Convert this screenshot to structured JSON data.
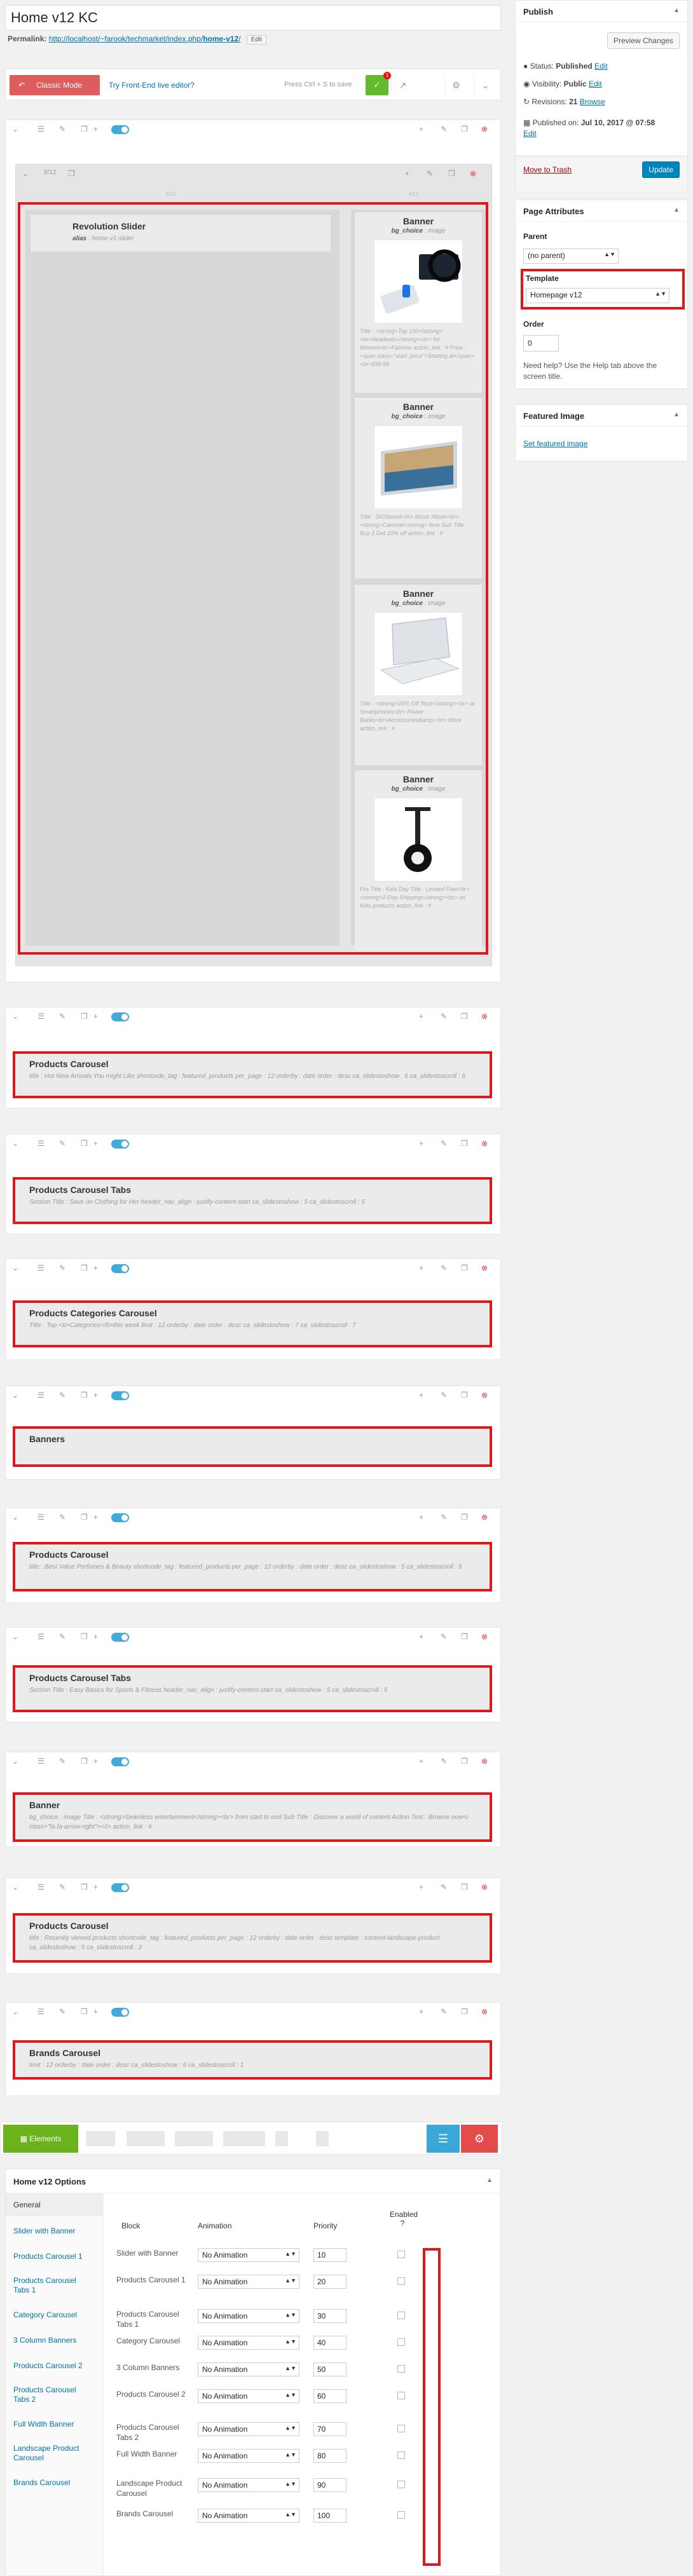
{
  "title_value": "Home v12 KC",
  "permalink": {
    "label": "Permalink:",
    "url_prefix": "http://localhost/~farook/techmarket/index.php/",
    "slug": "home-v12",
    "url_suffix": "/",
    "edit": "Edit"
  },
  "toolbar": {
    "classic_mode": "Classic Mode",
    "frontend_link": "Try Front-End live editor?",
    "save_hint": "Press Ctrl + S to save",
    "badge": "1"
  },
  "rev_slider": {
    "title": "Revolution Slider",
    "attr_key": "alias",
    "attr_value": ": home-v1-slider"
  },
  "col_widths": {
    "left": "8/12",
    "right": "4/12"
  },
  "banners": [
    {
      "title": "Banner",
      "key": "bg_choice",
      "val": ": image",
      "desc": "Title : <strong>Top 100</strong><br>Headsets</strong><br> for Women<br>Fashion action_link : # Price : <span class=\"start_price\">Starting at</span><br>$99.99"
    },
    {
      "title": "Banner",
      "key": "bg_choice",
      "val": ": image",
      "desc": "Title : 360Sound<br> Music Album<br><strong>Carnival</strong> time Sub Title : Buy 3 Get 10% off action_link : #"
    },
    {
      "title": "Banner",
      "key": "bg_choice",
      "val": ": image",
      "desc": "Title : <strong>20% Off Tech</strong><br> at Smartphones<br> Power Banks<br>Accessories&amp;<br> More action_link : #"
    },
    {
      "title": "Banner",
      "key": "bg_choice",
      "val": ": image",
      "desc": "Pre Title : Kids Day Title : Limited Free<br><strong>2-Day Shipping</strong><br> on Kids products action_link : #"
    }
  ],
  "rows": [
    {
      "title": "Products Carousel",
      "desc": "title : Hot New Arrivals You might Like shortcode_tag : featured_products per_page : 12 orderby : date order : desc ca_slidestoshow : 6 ca_slidestoscroll : 6"
    },
    {
      "title": "Products Carousel Tabs",
      "desc": "Section Title : Save on Clothing for Her header_nav_align : justify-content-start ca_slidestoshow : 5 ca_slidestoscroll : 5"
    },
    {
      "title": "Products Categories Carousel",
      "desc": "Title : Top <b>Categories</b>this week limit : 12 orderby : date order : desc ca_slidestoshow : 7 ca_slidestoscroll : 7"
    },
    {
      "title": "Banners",
      "desc": ""
    },
    {
      "title": "Products Carousel",
      "desc": "title : Best Value Perfumes & Beauty shortcode_tag : featured_products per_page : 12 orderby : date order : desc ca_slidestoshow : 5 ca_slidestoscroll : 5"
    },
    {
      "title": "Products Carousel Tabs",
      "desc": "Section Title : Easy Basics for Sports & Fitness header_nav_align : justify-content-start ca_slidestoshow : 5 ca_slidestoscroll : 5"
    },
    {
      "title": "Banner",
      "desc": "bg_choice : image Title : <strong>Seamless entertainment</strong><br> from start to end Sub Title : Discover a world of content Action Text : Browse now<i class=\"fa fa-arrow-right\"></i> action_link : #"
    },
    {
      "title": "Products Carousel",
      "desc": "title : Recently viewed products shortcode_tag : featured_products per_page : 12 orderby : date order : desc template : content-landscape-product ca_slidestoshow : 5 ca_slidestoscroll : 2"
    },
    {
      "title": "Brands Carousel",
      "desc": "limit : 12 orderby : date order : desc ca_slidestoshow : 6 ca_slidestoscroll : 1"
    }
  ],
  "elements_label": "Elements",
  "publish": {
    "title": "Publish",
    "preview": "Preview Changes",
    "status_label": "Status:",
    "status": "Published",
    "visibility_label": "Visibility:",
    "visibility": "Public",
    "revisions_label": "Revisions:",
    "revisions": "21",
    "browse": "Browse",
    "published_label": "Published on:",
    "published_date": "Jul 10, 2017 @ 07:58",
    "edit": "Edit",
    "trash": "Move to Trash",
    "update": "Update"
  },
  "page_attributes": {
    "title": "Page Attributes",
    "parent_label": "Parent",
    "parent_value": "(no parent)",
    "template_label": "Template",
    "template_value": "Homepage v12",
    "order_label": "Order",
    "order_value": "0",
    "help": "Need help? Use the Help tab above the screen title."
  },
  "featured_image": {
    "title": "Featured Image",
    "link": "Set featured image"
  },
  "options": {
    "title": "Home v12 Options",
    "nav": [
      "General",
      "Slider with Banner",
      "Products Carousel 1",
      "Products Carousel Tabs 1",
      "Category Carousel",
      "3 Column Banners",
      "Products Carousel 2",
      "Products Carousel Tabs 2",
      "Full Width Banner",
      "Landscape Product Carousel",
      "Brands Carousel"
    ],
    "headers": {
      "block": "Block",
      "animation": "Animation",
      "priority": "Priority",
      "enabled": "Enabled ?"
    },
    "rows": [
      {
        "block": "Slider with Banner",
        "animation": "No Animation",
        "priority": "10"
      },
      {
        "block": "Products Carousel 1",
        "animation": "No Animation",
        "priority": "20"
      },
      {
        "block": "Products Carousel Tabs 1",
        "animation": "No Animation",
        "priority": "30"
      },
      {
        "block": "Category Carousel",
        "animation": "No Animation",
        "priority": "40"
      },
      {
        "block": "3 Column Banners",
        "animation": "No Animation",
        "priority": "50"
      },
      {
        "block": "Products Carousel 2",
        "animation": "No Animation",
        "priority": "60"
      },
      {
        "block": "Products Carousel Tabs 2",
        "animation": "No Animation",
        "priority": "70"
      },
      {
        "block": "Full Width Banner",
        "animation": "No Animation",
        "priority": "80"
      },
      {
        "block": "Landscape Product Carousel",
        "animation": "No Animation",
        "priority": "90"
      },
      {
        "block": "Brands Carousel",
        "animation": "No Animation",
        "priority": "100"
      }
    ]
  },
  "colors": {
    "accent": "#0073aa",
    "highlight": "#e0171b",
    "save": "#62bb2e",
    "classic": "#dd5c5c"
  }
}
